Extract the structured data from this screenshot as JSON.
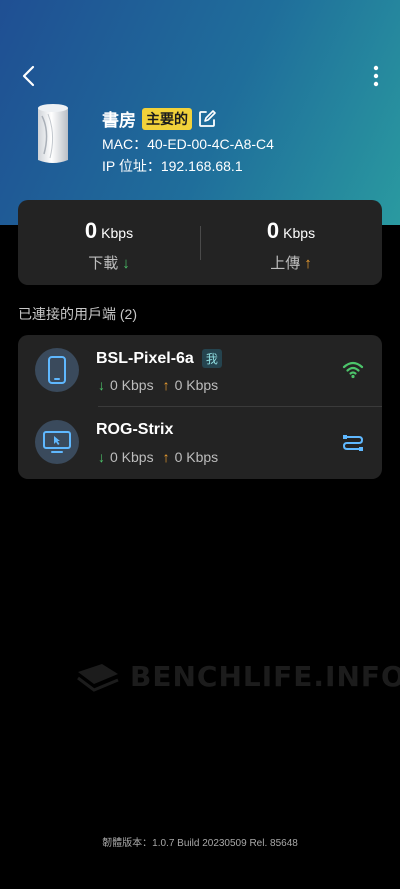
{
  "header": {
    "back_icon": "back-arrow-icon",
    "more_icon": "more-vertical-icon"
  },
  "device": {
    "name": "書房",
    "role_badge": "主要的",
    "mac": "MAC：40-ED-00-4C-A8-C4",
    "ip": "IP 位址：192.168.68.1",
    "badge_color": "#f2d23a"
  },
  "stats": {
    "download": {
      "value": "0",
      "unit": "Kbps",
      "label": "下載",
      "arrow": "↓"
    },
    "upload": {
      "value": "0",
      "unit": "Kbps",
      "label": "上傳",
      "arrow": "↑"
    }
  },
  "clients": {
    "title": "已連接的用戶端 (2)",
    "items": [
      {
        "name": "BSL-Pixel-6a",
        "tag": "我",
        "down": "0 Kbps",
        "up": "0 Kbps",
        "device_icon": "phone-icon",
        "connection_icon": "wifi-icon",
        "arrow_down": "↓",
        "arrow_up": "↑"
      },
      {
        "name": "ROG-Strix",
        "down": "0 Kbps",
        "up": "0 Kbps",
        "device_icon": "monitor-icon",
        "connection_icon": "ethernet-icon",
        "arrow_down": "↓",
        "arrow_up": "↑"
      }
    ]
  },
  "watermark": {
    "text": "BENCHLIFE.INFO"
  },
  "footer": {
    "firmware": "韌體版本：1.0.7 Build 20230509 Rel. 85648"
  },
  "colors": {
    "accent_green": "#4cc46a",
    "accent_orange": "#f0a030",
    "card_bg": "#232323"
  }
}
